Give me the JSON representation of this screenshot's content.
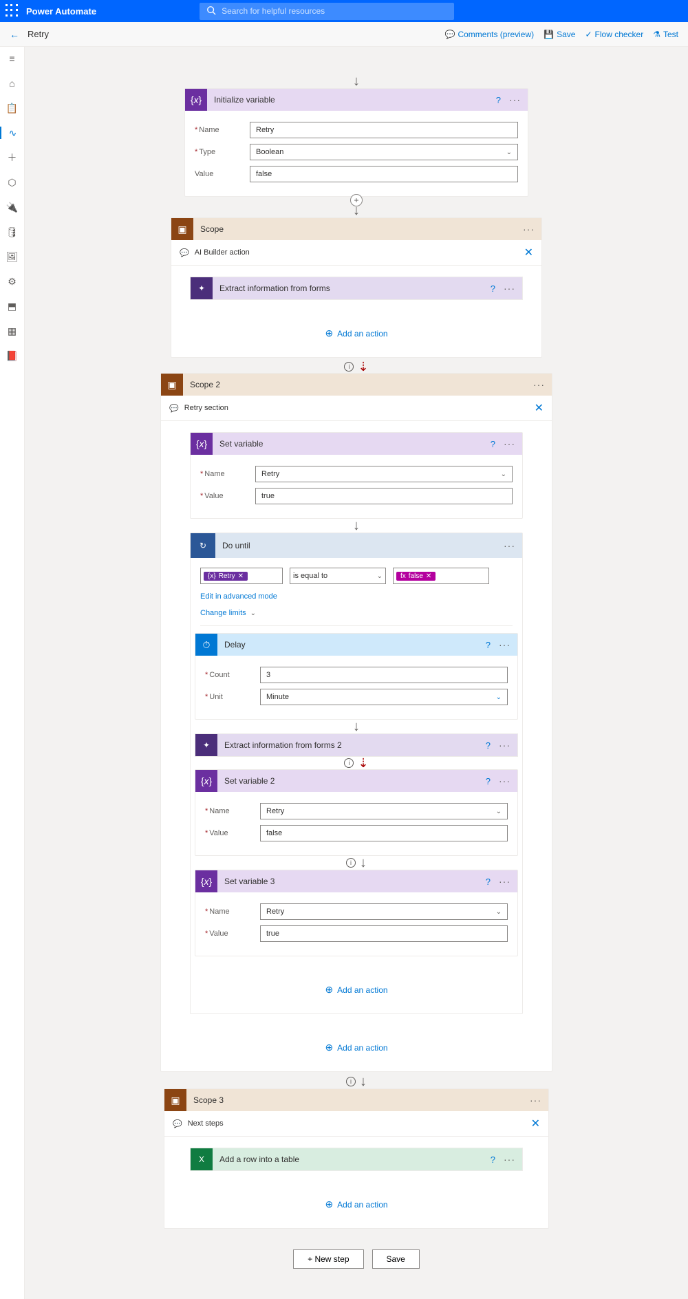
{
  "topbar": {
    "app_title": "Power Automate",
    "search_placeholder": "Search for helpful resources"
  },
  "breadcrumb": {
    "flow_title": "Retry",
    "actions": {
      "comments": "Comments (preview)",
      "save": "Save",
      "flow_checker": "Flow checker",
      "test": "Test"
    }
  },
  "init_var": {
    "title": "Initialize variable",
    "name_label": "Name",
    "name_value": "Retry",
    "type_label": "Type",
    "type_value": "Boolean",
    "value_label": "Value",
    "value_value": "false"
  },
  "scope1": {
    "title": "Scope",
    "comment": "AI Builder action",
    "extract_title": "Extract information from forms",
    "add_action": "Add an action"
  },
  "scope2": {
    "title": "Scope 2",
    "comment": "Retry section",
    "set_var": {
      "title": "Set variable",
      "name_label": "Name",
      "name_value": "Retry",
      "value_label": "Value",
      "value_value": "true"
    },
    "do_until": {
      "title": "Do until",
      "cond_left_pill": "Retry",
      "cond_op": "is equal to",
      "cond_right_pill": "false",
      "edit_advanced": "Edit in advanced mode",
      "change_limits": "Change limits"
    },
    "delay": {
      "title": "Delay",
      "count_label": "Count",
      "count_value": "3",
      "unit_label": "Unit",
      "unit_value": "Minute"
    },
    "extract2_title": "Extract information from forms 2",
    "set_var2": {
      "title": "Set variable 2",
      "name_label": "Name",
      "name_value": "Retry",
      "value_label": "Value",
      "value_value": "false"
    },
    "set_var3": {
      "title": "Set variable 3",
      "name_label": "Name",
      "name_value": "Retry",
      "value_label": "Value",
      "value_value": "true"
    },
    "add_action_inner": "Add an action",
    "add_action_outer": "Add an action"
  },
  "scope3": {
    "title": "Scope 3",
    "comment": "Next steps",
    "excel_title": "Add a row into a table",
    "add_action": "Add an action"
  },
  "buttons": {
    "new_step": "+ New step",
    "save": "Save"
  },
  "fx_label": "fx"
}
